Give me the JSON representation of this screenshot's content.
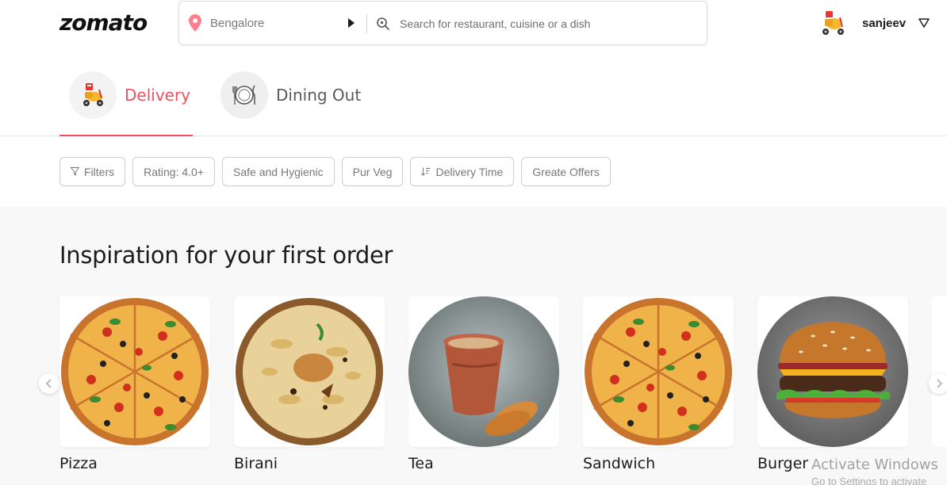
{
  "header": {
    "logo": "zomato",
    "location": "Bengalore",
    "search_placeholder": "Search for restaurant, cuisine or a dish",
    "username": "sanjeev"
  },
  "tabs": [
    {
      "label": "Delivery",
      "active": true
    },
    {
      "label": "Dining Out",
      "active": false
    }
  ],
  "filters": [
    {
      "label": "Filters",
      "icon": "filter-icon"
    },
    {
      "label": "Rating: 4.0+"
    },
    {
      "label": "Safe and Hygienic"
    },
    {
      "label": "Pur Veg"
    },
    {
      "label": "Delivery Time",
      "icon": "sort-icon"
    },
    {
      "label": "Greate Offers"
    }
  ],
  "inspiration": {
    "title": "Inspiration for your first order",
    "items": [
      {
        "name": "Pizza",
        "image": "pizza-image"
      },
      {
        "name": "Birani",
        "image": "biryani-image"
      },
      {
        "name": "Tea",
        "image": "tea-image"
      },
      {
        "name": "Sandwich",
        "image": "pizza-image"
      },
      {
        "name": "Burger",
        "image": "burger-image"
      }
    ]
  },
  "watermark": {
    "line1": "Activate Windows",
    "line2": "Go to Settings to activate"
  },
  "colors": {
    "brand": "#ef4f5f",
    "section_bg": "#f8f8f8"
  }
}
